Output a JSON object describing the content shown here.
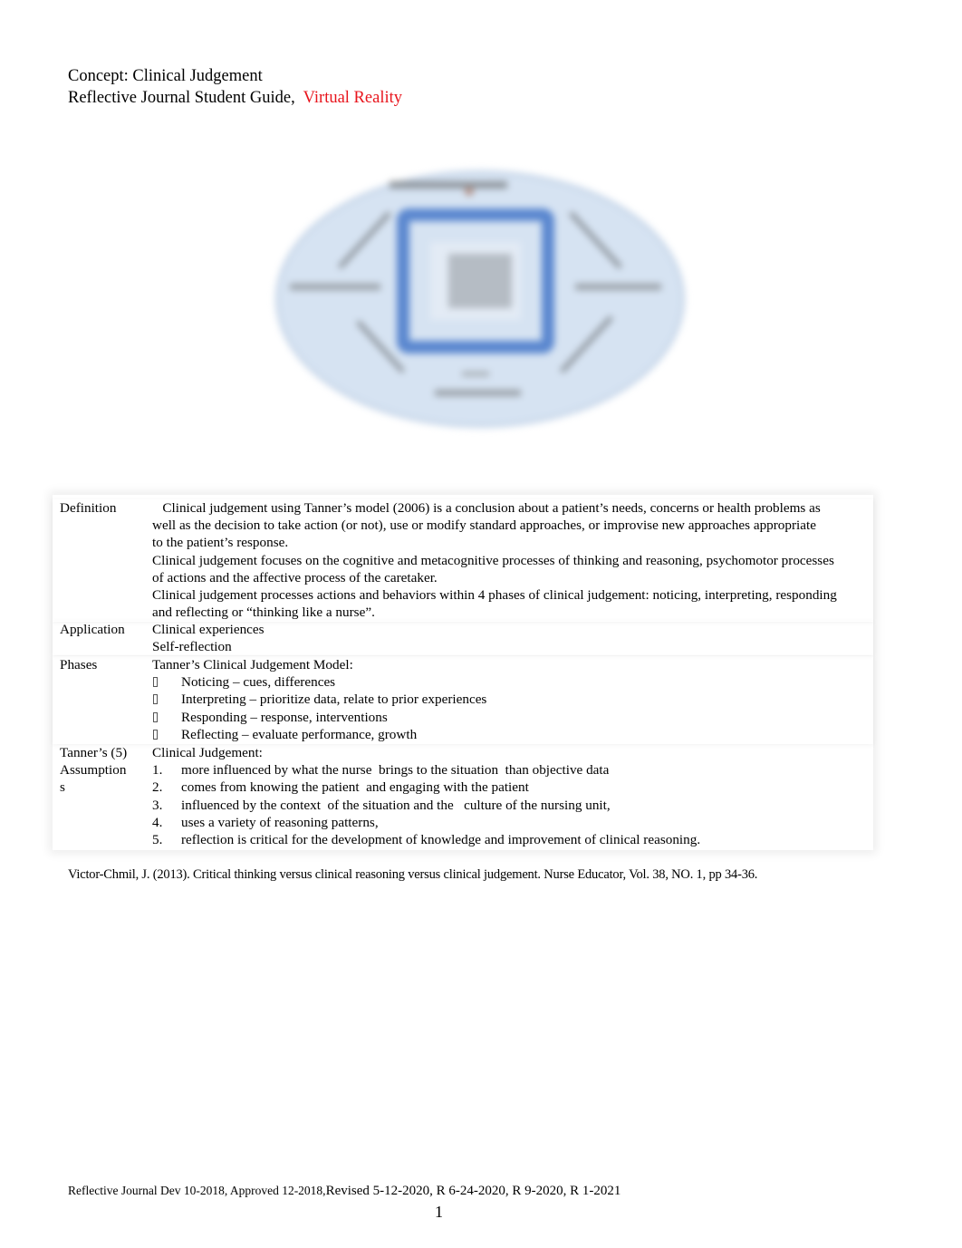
{
  "header": {
    "line1": "Concept: Clinical Judgement",
    "line2_prefix": "Reflective Journal Student Guide,",
    "line2_accent": "Virtual Reality",
    "accent_color": "#e8141c"
  },
  "diagram": {
    "description": "Tanner's Clinical Judgement Model diagram (blurred, text illegible)",
    "icon": "clinical-judgement-model-diagram"
  },
  "table": {
    "definition": {
      "label": "Definition",
      "lines": [
        "   Clinical judgement using Tanner’s model (2006) is a conclusion about a patient’s needs, concerns or health problems as",
        "well as the decision to take action (or not), use or modify standard approaches, or improvise new approaches appropriate",
        "to the patient’s response.",
        "Clinical judgement focuses on the cognitive and metacognitive processes of thinking and reasoning, psychomotor processes",
        "of actions and the affective process of the caretaker.",
        "Clinical judgement processes actions and behaviors within 4 phases of clinical judgement: noticing, interpreting, responding",
        "and reflecting or “thinking like a nurse”."
      ]
    },
    "application": {
      "label": "Application",
      "items": [
        "Clinical experiences",
        "Self-reflection"
      ]
    },
    "phases": {
      "label": "Phases",
      "intro": "Tanner’s Clinical Judgement Model:",
      "items": [
        "Noticing – cues, differences",
        "Interpreting – prioritize data, relate to prior experiences",
        "Responding – response, interventions",
        "Reflecting – evaluate performance, growth"
      ]
    },
    "assumptions": {
      "label_lines": [
        "Tanner’s (5)",
        "Assumption",
        "s"
      ],
      "intro": "Clinical Judgement:",
      "items": [
        {
          "num": "1.",
          "text": "more influenced by what the nurse  brings to the situation  than objective data"
        },
        {
          "num": "2.",
          "text": "comes from knowing the patient  and engaging with the patient"
        },
        {
          "num": "3.",
          "text": "influenced by the context  of the situation and the   culture of the nursing unit,"
        },
        {
          "num": "4.",
          "text": "uses a variety of reasoning patterns,"
        },
        {
          "num": "5.",
          "text": "reflection is critical for the development of knowledge and improvement of clinical reasoning."
        }
      ]
    }
  },
  "citation": "Victor-Chmil, J. (2013). Critical thinking versus clinical reasoning versus clinical judgement. Nurse Educator, Vol. 38, NO. 1, pp 34-36.",
  "footer": {
    "dev_text": "Reflective Journal Dev 10-2018, Approved 12-2018,",
    "revised_text": "Revised 5-12-2020, R 6-24-2020, R 9-2020, R 1-2021",
    "page_number": "1"
  }
}
